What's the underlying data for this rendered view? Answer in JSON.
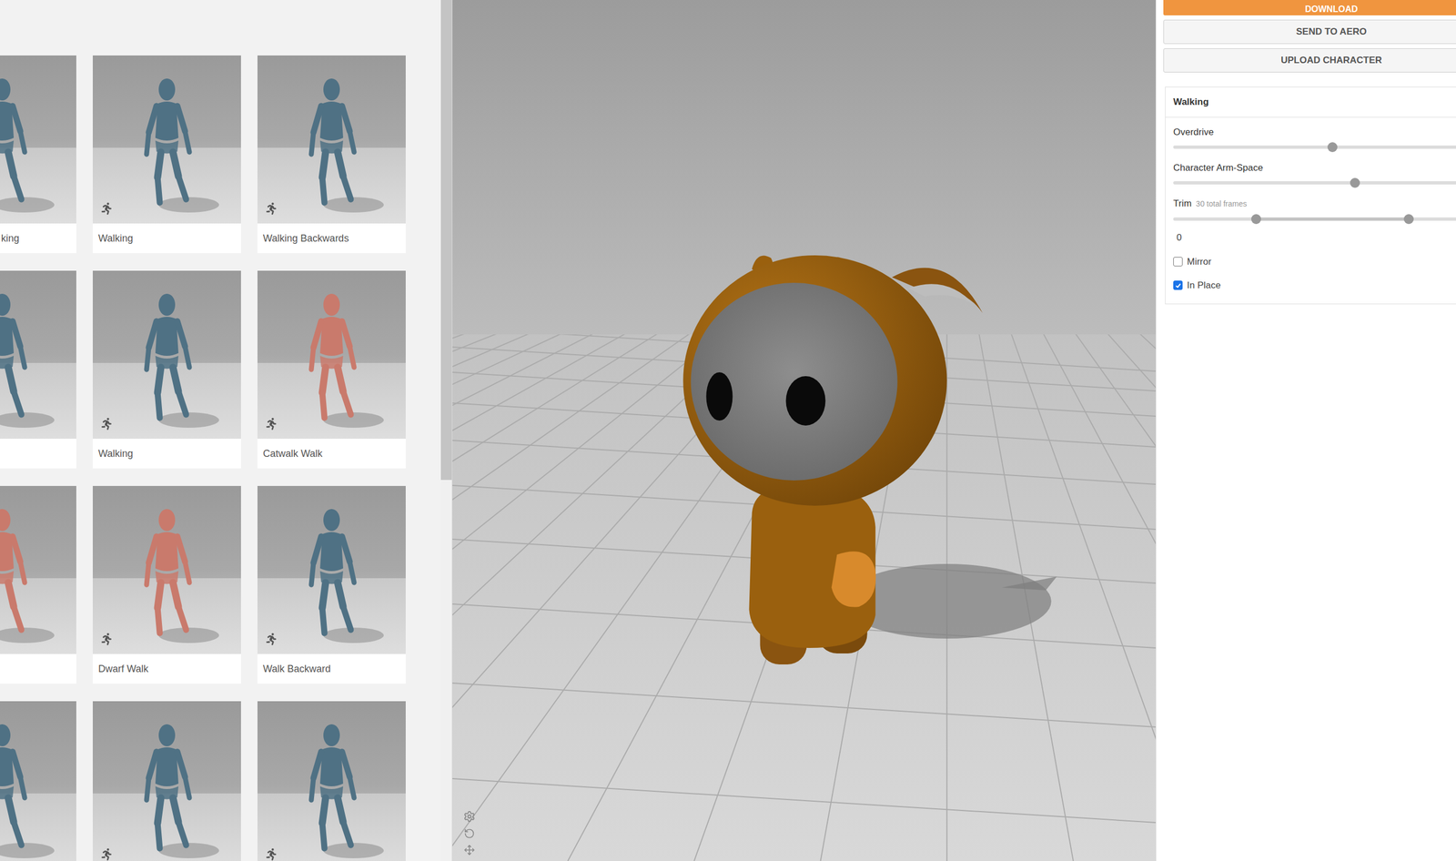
{
  "animations": [
    {
      "kind": "cut",
      "label": "king",
      "color": "#4f7184"
    },
    {
      "kind": "full",
      "label": "Walking",
      "color": "#4f7184"
    },
    {
      "kind": "full",
      "label": "Walking Backwards",
      "color": "#4f7184"
    },
    {
      "kind": "cut",
      "label": "",
      "color": "#4f7184"
    },
    {
      "kind": "full",
      "label": "Walking",
      "color": "#4f7184"
    },
    {
      "kind": "full",
      "label": "Catwalk Walk",
      "color": "#c97a6c"
    },
    {
      "kind": "cut",
      "label": "",
      "color": "#c97a6c"
    },
    {
      "kind": "full",
      "label": "Dwarf Walk",
      "color": "#c97a6c"
    },
    {
      "kind": "full",
      "label": "Walk Backward",
      "color": "#4f7184"
    },
    {
      "kind": "cut",
      "label": "",
      "color": "#4f7184"
    },
    {
      "kind": "full",
      "label": "",
      "color": "#4f7184"
    },
    {
      "kind": "full",
      "label": "",
      "color": "#4f7184"
    }
  ],
  "actions": [
    {
      "label": "DOWNLOAD",
      "primary": true
    },
    {
      "label": "SEND TO AERO",
      "primary": false
    },
    {
      "label": "UPLOAD CHARACTER",
      "primary": false
    }
  ],
  "settings": {
    "title": "Walking",
    "controls": [
      {
        "kind": "slider",
        "label": "Overdrive",
        "level": 0.5
      },
      {
        "kind": "slider",
        "label": "Character Arm-Space",
        "level": 0.57
      },
      {
        "kind": "range",
        "label": "Trim",
        "note": "30 total frames",
        "level_start": 0.26,
        "level_end": 0.74,
        "reading": "0"
      },
      {
        "kind": "checkbox",
        "label": "Mirror",
        "checked": false
      },
      {
        "kind": "checkbox",
        "label": "In Place",
        "checked": true
      }
    ]
  }
}
